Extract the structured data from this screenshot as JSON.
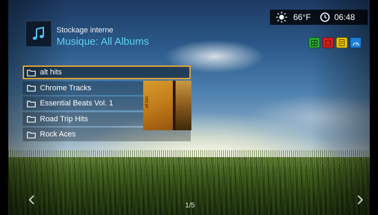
{
  "header": {
    "subtitle": "Stockage interne",
    "title": "Musique: All Albums",
    "app_icon": "music-note-icon"
  },
  "status": {
    "weather_icon": "sun-icon",
    "temperature": "66°F",
    "clock_icon": "clock-icon",
    "time": "06:48"
  },
  "color_buttons": [
    {
      "name": "green",
      "color": "#2aa832",
      "icon": "grid-icon"
    },
    {
      "name": "red",
      "color": "#d12020",
      "icon": "red-glyph-icon"
    },
    {
      "name": "yellow",
      "color": "#e8c400",
      "icon": "doc-icon"
    },
    {
      "name": "blue",
      "color": "#1c7ed6",
      "icon": "dial-icon"
    }
  ],
  "list": {
    "items": [
      {
        "label": "alt hits",
        "selected": true
      },
      {
        "label": "Chrome Tracks",
        "selected": false
      },
      {
        "label": "Essential Beats Vol. 1",
        "selected": false
      },
      {
        "label": "Road Trip Hits",
        "selected": false
      },
      {
        "label": "Rock Aces",
        "selected": false
      }
    ]
  },
  "album_art": {
    "label": "alt hits"
  },
  "pager": {
    "indicator": "1/5"
  },
  "colors": {
    "accent_title": "#5fd4f6",
    "selection_border": "#e0a436"
  }
}
